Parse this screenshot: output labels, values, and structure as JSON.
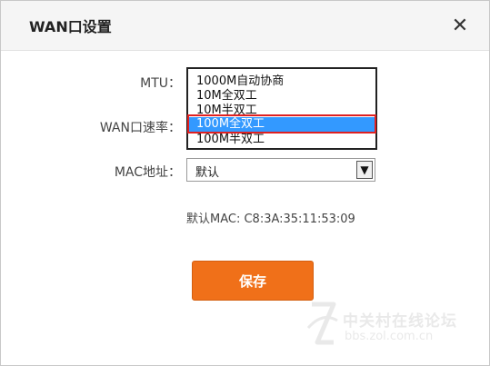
{
  "dialog": {
    "title": "WAN口设置",
    "close_icon": "close-icon"
  },
  "form": {
    "mtu_label": "MTU：",
    "speed_label": "WAN口速率：",
    "mac_label": "MAC地址：",
    "speed_options": [
      "1000M自动协商",
      "10M全双工",
      "10M半双工",
      "100M全双工",
      "100M半双工"
    ],
    "speed_selected": "100M全双工",
    "mac_select_value": "默认",
    "default_mac_text": "默认MAC: C8:3A:35:11:53:09",
    "save_label": "保存"
  },
  "watermark": {
    "cn_text": "中关村在线论坛",
    "url": "bbs.zol.com.cn"
  },
  "colors": {
    "accent": "#f07019",
    "selection": "#3399ff",
    "highlight_border": "#e02020"
  }
}
